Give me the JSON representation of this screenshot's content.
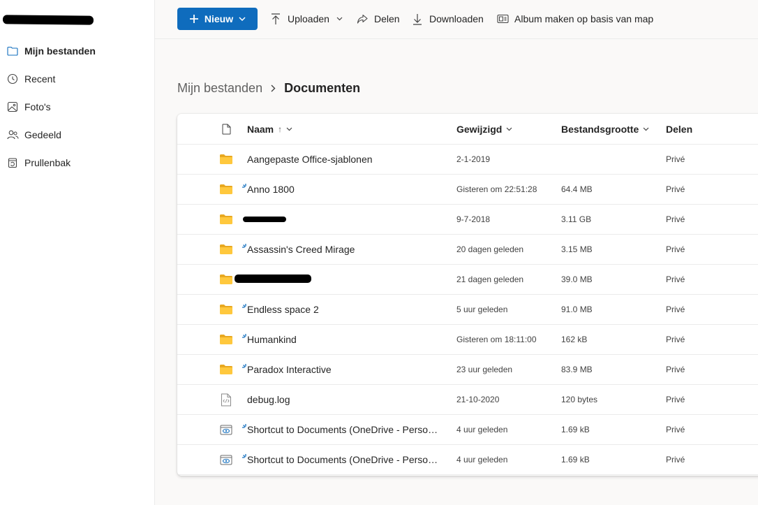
{
  "sidebar": {
    "items": [
      {
        "label": "Mijn bestanden",
        "icon": "folder-icon",
        "active": true
      },
      {
        "label": "Recent",
        "icon": "clock-icon"
      },
      {
        "label": "Foto's",
        "icon": "photo-icon"
      },
      {
        "label": "Gedeeld",
        "icon": "people-icon"
      },
      {
        "label": "Prullenbak",
        "icon": "trash-icon"
      }
    ]
  },
  "toolbar": {
    "new_label": "Nieuw",
    "upload_label": "Uploaden",
    "share_label": "Delen",
    "download_label": "Downloaden",
    "album_label": "Album maken op basis van map"
  },
  "breadcrumb": {
    "root": "Mijn bestanden",
    "current": "Documenten"
  },
  "table": {
    "headers": {
      "name": "Naam",
      "sort_arrow": "↑",
      "modified": "Gewijzigd",
      "size": "Bestandsgrootte",
      "sharing": "Delen"
    },
    "rows": [
      {
        "type": "folder",
        "name": "Aangepaste Office-sjablonen",
        "modified": "2-1-2019",
        "size": "",
        "sharing": "Privé",
        "syncing": false
      },
      {
        "type": "folder",
        "name": "Anno 1800",
        "modified": "Gisteren om 22:51:28",
        "size": "64.4 MB",
        "sharing": "Privé",
        "syncing": true
      },
      {
        "type": "folder",
        "name": "",
        "modified": "9-7-2018",
        "size": "3.11 GB",
        "sharing": "Privé",
        "syncing": false,
        "redacted": "a"
      },
      {
        "type": "folder",
        "name": "Assassin's Creed Mirage",
        "modified": "20 dagen geleden",
        "size": "3.15 MB",
        "sharing": "Privé",
        "syncing": true
      },
      {
        "type": "folder",
        "name": "",
        "modified": "21 dagen geleden",
        "size": "39.0 MB",
        "sharing": "Privé",
        "syncing": false,
        "redacted": "b"
      },
      {
        "type": "folder",
        "name": "Endless space 2",
        "modified": "5 uur geleden",
        "size": "91.0 MB",
        "sharing": "Privé",
        "syncing": true
      },
      {
        "type": "folder",
        "name": "Humankind",
        "modified": "Gisteren om 18:11:00",
        "size": "162 kB",
        "sharing": "Privé",
        "syncing": true
      },
      {
        "type": "folder",
        "name": "Paradox Interactive",
        "modified": "23 uur geleden",
        "size": "83.9 MB",
        "sharing": "Privé",
        "syncing": true
      },
      {
        "type": "log",
        "name": "debug.log",
        "modified": "21-10-2020",
        "size": "120 bytes",
        "sharing": "Privé",
        "syncing": false
      },
      {
        "type": "shortcut",
        "name": "Shortcut to Documents (OneDrive - Person…",
        "modified": "4 uur geleden",
        "size": "1.69 kB",
        "sharing": "Privé",
        "syncing": true
      },
      {
        "type": "shortcut",
        "name": "Shortcut to Documents (OneDrive - Person…",
        "modified": "4 uur geleden",
        "size": "1.69 kB",
        "sharing": "Privé",
        "syncing": true
      }
    ]
  },
  "colors": {
    "accent": "#0f6cbd",
    "folder": "#ffc83d",
    "folder_dark": "#e8a820",
    "sync": "#0f6cbd"
  }
}
